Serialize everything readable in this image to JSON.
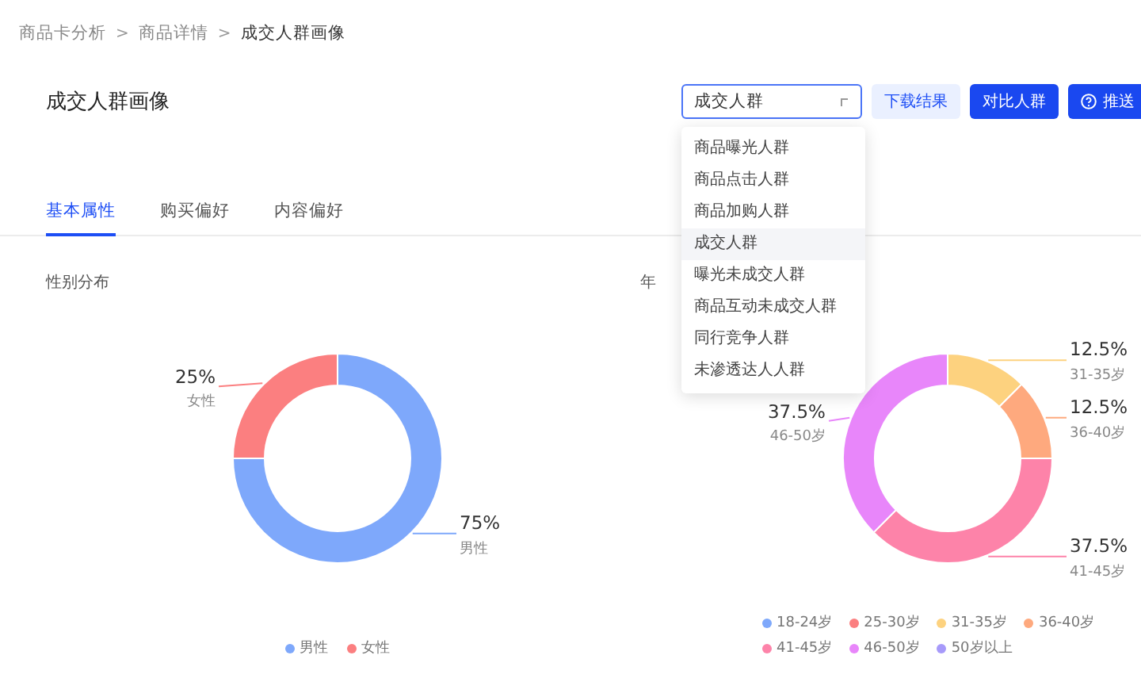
{
  "breadcrumb": [
    {
      "label": "商品卡分析",
      "current": false
    },
    {
      "label": "商品详情",
      "current": false
    },
    {
      "label": "成交人群画像",
      "current": true
    }
  ],
  "breadcrumb_separator": ">",
  "page_title": "成交人群画像",
  "audience_select": {
    "value": "成交人群",
    "expanded": true,
    "options": [
      {
        "label": "商品曝光人群",
        "selected": false
      },
      {
        "label": "商品点击人群",
        "selected": false
      },
      {
        "label": "商品加购人群",
        "selected": false
      },
      {
        "label": "成交人群",
        "selected": true
      },
      {
        "label": "曝光未成交人群",
        "selected": false
      },
      {
        "label": "商品互动未成交人群",
        "selected": false
      },
      {
        "label": "同行竞争人群",
        "selected": false
      },
      {
        "label": "未渗透达人人群",
        "selected": false
      }
    ]
  },
  "buttons": [
    {
      "label": "下载结果",
      "kind": "secondary"
    },
    {
      "label": "对比人群",
      "kind": "primary"
    },
    {
      "label": "推送",
      "kind": "primary-help"
    }
  ],
  "tabs": [
    {
      "label": "基本属性",
      "selected": true
    },
    {
      "label": "购买偏好",
      "selected": false
    },
    {
      "label": "内容偏好",
      "selected": false
    }
  ],
  "panels": [
    {
      "title": "性别分布",
      "chart_data": {
        "type": "donut",
        "categories": [
          "男性",
          "女性"
        ],
        "values": [
          75,
          25
        ],
        "colors": [
          "#7ea8fb",
          "#fb7f80"
        ],
        "value_labels": [
          "75%",
          "25%"
        ]
      },
      "legend": [
        {
          "label": "男性",
          "color": "#7ea8fb"
        },
        {
          "label": "女性",
          "color": "#fb7f80"
        }
      ]
    },
    {
      "title": "年",
      "chart_data": {
        "type": "donut",
        "categories": [
          "31-35岁",
          "36-40岁",
          "41-45岁",
          "46-50岁"
        ],
        "values": [
          12.5,
          12.5,
          37.5,
          37.5
        ],
        "colors": [
          "#fdd27f",
          "#fea97e",
          "#fd83a9",
          "#e886fa"
        ],
        "value_labels": [
          "12.5%",
          "12.5%",
          "37.5%",
          "37.5%"
        ]
      },
      "legend": [
        {
          "label": "18-24岁",
          "color": "#7ea8fb"
        },
        {
          "label": "25-30岁",
          "color": "#fb7f80"
        },
        {
          "label": "31-35岁",
          "color": "#fdd27f"
        },
        {
          "label": "36-40岁",
          "color": "#fea97e"
        },
        {
          "label": "41-45岁",
          "color": "#fd83a9"
        },
        {
          "label": "46-50岁",
          "color": "#e886fa"
        },
        {
          "label": "50岁以上",
          "color": "#a79afa"
        }
      ]
    }
  ]
}
